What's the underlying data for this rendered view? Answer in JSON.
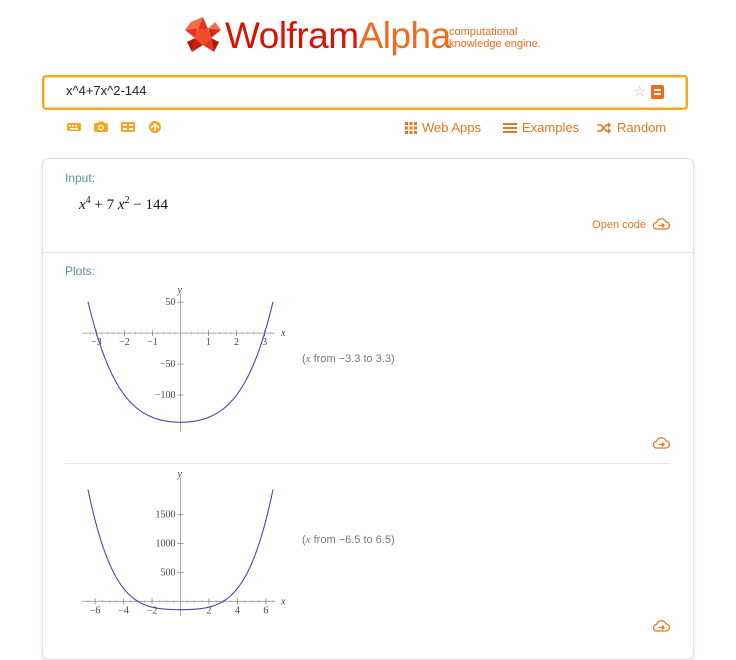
{
  "brand": {
    "name_main": "Wolfram",
    "name_alpha": "Alpha",
    "tagline_1": "computational",
    "tagline_2": "knowledge engine."
  },
  "search": {
    "value": "x^4+7x^2-144"
  },
  "nav": {
    "web_apps": "Web Apps",
    "examples": "Examples",
    "random": "Random"
  },
  "input_pod": {
    "title": "Input:",
    "formula": {
      "t1": "x",
      "e1": "4",
      "t2": " + 7 ",
      "t3": "x",
      "e2": "2",
      "t4": " − 144"
    },
    "open_code": "Open code"
  },
  "plots_pod": {
    "title": "Plots:",
    "plot1": {
      "range_var": "x",
      "range_text": " from −3.3 to 3.3)",
      "range_open": "(",
      "x_label": "x",
      "y_label": "y",
      "x_ticks": [
        "−3",
        "−2",
        "−1",
        "1",
        "2",
        "3"
      ],
      "y_ticks": [
        "50",
        "−50",
        "−100"
      ]
    },
    "plot2": {
      "range_var": "x",
      "range_text": " from −6.5 to 6.5)",
      "range_open": "(",
      "x_label": "x",
      "y_label": "y",
      "x_ticks": [
        "−6",
        "−4",
        "−2",
        "2",
        "4",
        "6"
      ],
      "y_ticks": [
        "1500",
        "1000",
        "500"
      ]
    }
  },
  "chart_data": [
    {
      "type": "line",
      "function": "x^4+7x^2-144",
      "xlim": [
        -3.3,
        3.3
      ],
      "ylim": [
        -150,
        60
      ],
      "xlabel": "x",
      "ylabel": "y",
      "x_ticks": [
        -3,
        -2,
        -1,
        1,
        2,
        3
      ],
      "y_ticks": [
        50,
        -50,
        -100
      ],
      "color": "#4a4aa8"
    },
    {
      "type": "line",
      "function": "x^4+7x^2-144",
      "xlim": [
        -6.5,
        6.5
      ],
      "ylim": [
        -150,
        2100
      ],
      "xlabel": "x",
      "ylabel": "y",
      "x_ticks": [
        -6,
        -4,
        -2,
        2,
        4,
        6
      ],
      "y_ticks": [
        1500,
        1000,
        500
      ],
      "color": "#4a4aa8"
    }
  ],
  "colors": {
    "accent": "#f26b1d",
    "brand_red": "#dd1100",
    "label_blue": "#5a8eb0",
    "curve": "#4a4aa8"
  }
}
